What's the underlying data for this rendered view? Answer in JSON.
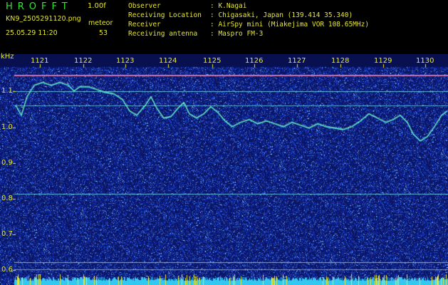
{
  "header": {
    "app_title": "HROFFT",
    "version": "1.00f",
    "file_name": "KN9_2505291120.png",
    "meteor_label": "meteor",
    "date_time": "25.05.29 11:20",
    "meteor_count": "53"
  },
  "info": [
    {
      "label": "Observer",
      "value": ": K.Nagai"
    },
    {
      "label": "Receiving Location",
      "value": ": Chigasaki, Japan (139.414 35.340)"
    },
    {
      "label": "Receiver",
      "value": ": AirSpy mini (Miakejima VOR 108.65MHz)"
    },
    {
      "label": "Receiving antenna",
      "value": ": Maspro FM-3"
    }
  ],
  "axis": {
    "unit_label": "kHz",
    "time_labels": [
      "1121",
      "1122",
      "1123",
      "1124",
      "1125",
      "1126",
      "1127",
      "1128",
      "1129",
      "1130"
    ],
    "freq_labels": [
      "1.1",
      "1.0",
      "0.9",
      "0.8",
      "0.7",
      "0.6"
    ]
  },
  "colors": {
    "background": "#000000",
    "header_text": "#e6e633",
    "title_green": "#33e633",
    "noise_base": "#0d1a6e",
    "trace": "#4df0f0",
    "marker": "#e6e633"
  }
}
